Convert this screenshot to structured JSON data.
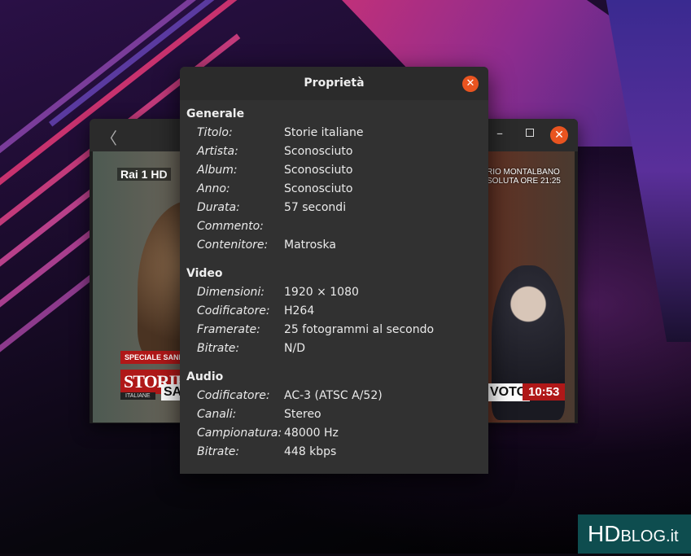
{
  "dialog": {
    "title": "Proprietà",
    "sections": [
      {
        "heading": "Generale",
        "rows": [
          {
            "label": "Titolo:",
            "value": "Storie italiane"
          },
          {
            "label": "Artista:",
            "value": "Sconosciuto"
          },
          {
            "label": "Album:",
            "value": "Sconosciuto"
          },
          {
            "label": "Anno:",
            "value": "Sconosciuto"
          },
          {
            "label": "Durata:",
            "value": "57 secondi"
          },
          {
            "label": "Commento:",
            "value": ""
          },
          {
            "label": "Contenitore:",
            "value": "Matroska"
          }
        ]
      },
      {
        "heading": "Video",
        "rows": [
          {
            "label": "Dimensioni:",
            "value": "1920 × 1080"
          },
          {
            "label": "Codificatore:",
            "value": "H264"
          },
          {
            "label": "Framerate:",
            "value": "25 fotogrammi al secondo"
          },
          {
            "label": "Bitrate:",
            "value": "N/D"
          }
        ]
      },
      {
        "heading": "Audio",
        "rows": [
          {
            "label": "Codificatore:",
            "value": "AC-3 (ATSC A/52)"
          },
          {
            "label": "Canali:",
            "value": "Stereo"
          },
          {
            "label": "Campionatura:",
            "value": "48000 Hz"
          },
          {
            "label": "Bitrate:",
            "value": "448 kbps"
          }
        ]
      }
    ],
    "close_icon": "close-icon"
  },
  "player": {
    "back_icon": "chevron-left-icon",
    "minimize_icon": "minimize-icon",
    "maximize_icon": "maximize-icon",
    "close_icon": "close-icon",
    "overlay": {
      "channel": "Rai 1 HD",
      "banner": "SPECIALE SANREMO",
      "show_title": "STORIE",
      "show_subtitle": "ITALIANE",
      "ticker_left": "SAN",
      "promo": "RIO MONTALBANO\nSOLUTA ORE 21:25",
      "ticker_right": "VOTO",
      "clock": "10:53"
    }
  },
  "watermark": {
    "brand": "HD",
    "suffix": "BLOG.it"
  },
  "colors": {
    "accent": "#e95420",
    "dialog_bg": "#313131",
    "header_bg": "#2b2b2b"
  }
}
